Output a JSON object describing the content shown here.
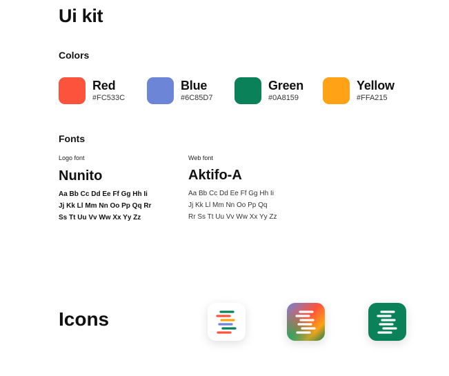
{
  "title": "Ui kit",
  "colors": {
    "heading": "Colors",
    "items": [
      {
        "name": "Red",
        "hex": "#FC533C"
      },
      {
        "name": "Blue",
        "hex": "#6C85D7"
      },
      {
        "name": "Green",
        "hex": "#0A8159"
      },
      {
        "name": "Yellow",
        "hex": "#FFA215"
      }
    ]
  },
  "fonts": {
    "heading": "Fonts",
    "logo": {
      "label": "Logo font",
      "name": "Nunito",
      "lines": [
        "Aa Bb Cc Dd Ee Ff Gg Hh Ii",
        "Jj Kk Ll Mm Nn Oo Pp Qq Rr",
        "Ss Tt Uu Vv Ww Xx Yy Zz"
      ]
    },
    "web": {
      "label": "Web font",
      "name": "Aktifo-A",
      "lines": [
        "Aa Bb Cc Dd Ee Ff Gg Hh Ii",
        "Jj Kk Ll Mm Nn Oo Pp Qq",
        "Rr  Ss Tt Uu Vv Ww Xx Yy Zz"
      ]
    }
  },
  "icons": {
    "heading": "Icons",
    "items": [
      {
        "style": "white",
        "icon": "app-logo-icon"
      },
      {
        "style": "gradient",
        "icon": "app-logo-icon"
      },
      {
        "style": "green",
        "icon": "app-logo-icon"
      }
    ]
  }
}
